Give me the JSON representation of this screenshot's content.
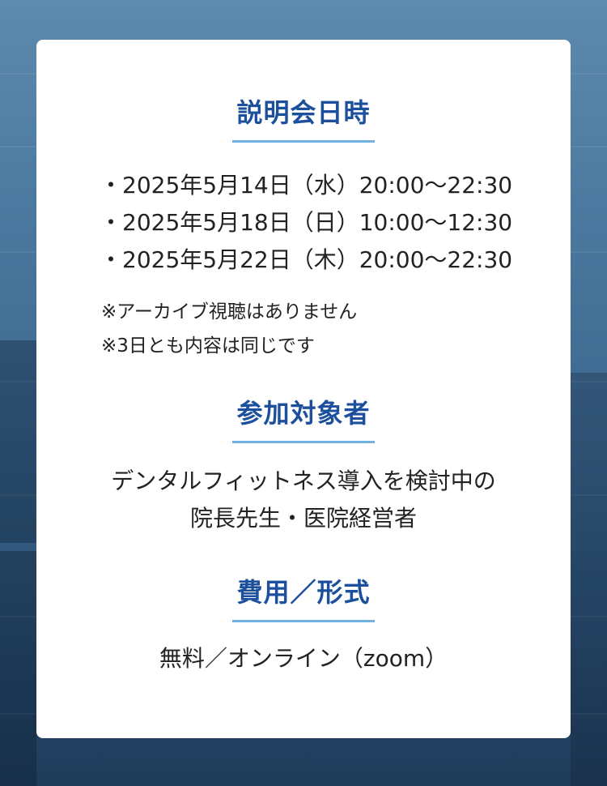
{
  "sections": {
    "schedule": {
      "title": "説明会日時",
      "bullet": "・",
      "dates": [
        "2025年5月14日（水）20:00〜22:30",
        "2025年5月18日（日）10:00〜12:30",
        "2025年5月22日（木）20:00〜22:30"
      ],
      "notes": [
        "※アーカイブ視聴はありません",
        "※3日とも内容は同じです"
      ]
    },
    "target": {
      "title": "参加対象者",
      "line1": "デンタルフィットネス導入を検討中の",
      "line2": "院長先生・医院経営者"
    },
    "fee": {
      "title": "費用／形式",
      "text": "無料／オンライン（zoom）"
    }
  },
  "colors": {
    "heading": "#1c4f9c",
    "underline": "#6fb1e0",
    "text": "#222222",
    "card": "#ffffff"
  }
}
